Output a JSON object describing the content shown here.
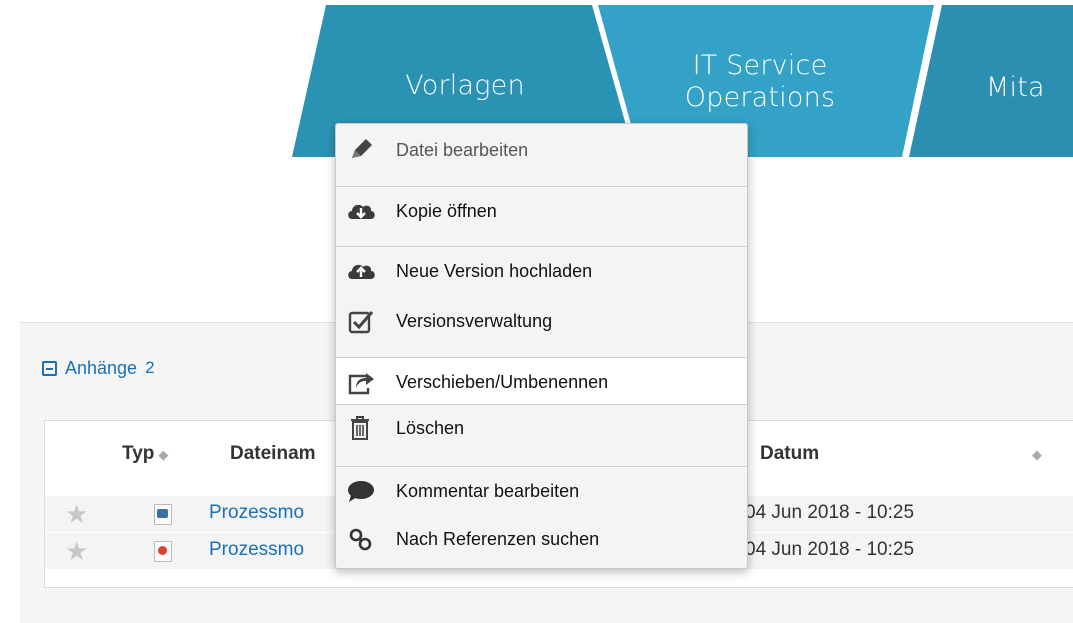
{
  "tabs": [
    {
      "label": "Vorlagen"
    },
    {
      "label": "IT Service Operations"
    },
    {
      "label": "Mita"
    }
  ],
  "colors": {
    "tab_fill": "#2a93b4",
    "tab_fill_2": "#33a2c6",
    "link": "#1a6fb5",
    "menu_bg": "#f4f4f4",
    "menu_hover": "#ffffff"
  },
  "attachments": {
    "title": "Anhänge",
    "count": "2",
    "columns": {
      "type": "Typ",
      "filename": "Dateinam",
      "date": "Datum"
    },
    "rows": [
      {
        "icon": "image-file-icon",
        "filename": "Prozessmo",
        "size": "",
        "date": "04 Jun 2018 - 10:25"
      },
      {
        "icon": "powerpoint-file-icon",
        "filename": "Prozessmo",
        "size": "",
        "date": "04 Jun 2018 - 10:25"
      }
    ]
  },
  "context_menu": {
    "items": [
      {
        "label": "Datei bearbeiten",
        "icon": "pencil-icon",
        "state": "disabled"
      },
      {
        "label": "Kopie öffnen",
        "icon": "cloud-download-icon"
      },
      {
        "label": "Neue Version hochladen",
        "icon": "cloud-upload-icon"
      },
      {
        "label": "Versionsverwaltung",
        "icon": "checkbox-icon"
      },
      {
        "label": "Verschieben/Umbenennen",
        "icon": "share-arrow-icon",
        "state": "hover"
      },
      {
        "label": "Löschen",
        "icon": "trash-icon"
      },
      {
        "label": "Kommentar bearbeiten",
        "icon": "comment-icon"
      },
      {
        "label": "Nach Referenzen suchen",
        "icon": "link-icon"
      }
    ]
  }
}
